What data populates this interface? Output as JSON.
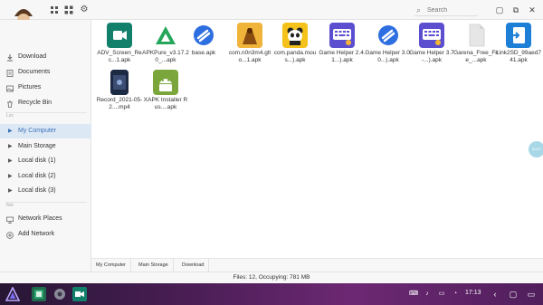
{
  "toolbar": {
    "search_placeholder": "Search"
  },
  "sidebar": {
    "items": [
      {
        "label": "Download",
        "icon": "download-icon"
      },
      {
        "label": "Documents",
        "icon": "document-icon"
      },
      {
        "label": "Pictures",
        "icon": "image-icon"
      },
      {
        "label": "Recycle Bin",
        "icon": "trash-icon"
      }
    ],
    "local_section_label": "Loc",
    "local_items": [
      {
        "label": "My Computer",
        "active": true
      },
      {
        "label": "Main Storage"
      },
      {
        "label": "Local disk (1)"
      },
      {
        "label": "Local disk (2)"
      },
      {
        "label": "Local disk (3)"
      }
    ],
    "net_section_label": "Net",
    "net_items": [
      {
        "label": "Network Places",
        "icon": "network-icon"
      },
      {
        "label": "Add Network",
        "icon": "add-network-icon"
      }
    ]
  },
  "files": [
    {
      "name": "ADV_Screen_Rec...1.apk",
      "icon": "adv-screen-recorder-icon",
      "color": "#13806b"
    },
    {
      "name": "APKPure_v3.17.20_...apk",
      "icon": "apkpure-icon",
      "color": "#26a65b"
    },
    {
      "name": "base.apk",
      "icon": "app-icon",
      "color": "#2d6ee0"
    },
    {
      "name": "com.n0n3m4.glto...1.apk",
      "icon": "game-icon",
      "color": "#e8a21c"
    },
    {
      "name": "com.panda.mous...).apk",
      "icon": "panda-mouse-icon",
      "color": "#f4c21a"
    },
    {
      "name": "Game Helper 2.4.1...).apk",
      "icon": "keyboard-helper-icon",
      "color": "#5b4fd0"
    },
    {
      "name": "Game Helper 3.0.0...).apk",
      "icon": "app-icon",
      "color": "#2d6ee0"
    },
    {
      "name": "Game Helper 3.7 -...).apk",
      "icon": "keyboard-helper-icon",
      "color": "#5b4fd0"
    },
    {
      "name": "Garena_Free_Fire_...apk",
      "icon": "blank-file-icon",
      "color": "#e4e4e4"
    },
    {
      "name": "Link2SD_99aed741.apk",
      "icon": "link2sd-icon",
      "color": "#1e7fd6"
    },
    {
      "name": "Record_2021-05-2....mp4",
      "icon": "video-file-icon",
      "color": "#1d2a44"
    },
    {
      "name": "XAPK Installer Rus....apk",
      "icon": "android-icon",
      "color": "#7aa63b"
    }
  ],
  "floating_bubble": "9/11F",
  "breadcrumb": [
    "My Computer",
    "Main Storage",
    "Download"
  ],
  "status_text": "Files: 12, Occupying: 781 MB",
  "taskbar": {
    "clock": "17:13",
    "accent": "#6d2873"
  }
}
